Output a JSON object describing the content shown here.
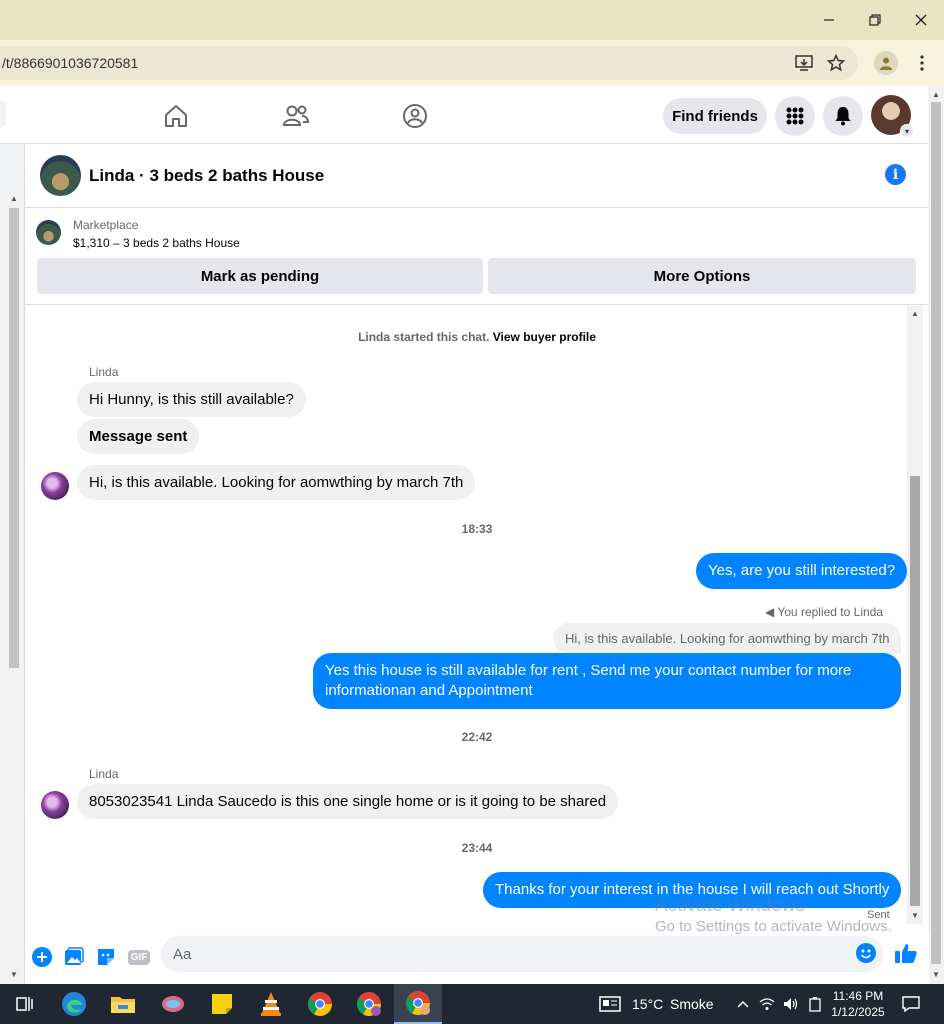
{
  "browser": {
    "url": "/t/8866901036720581",
    "window_controls": [
      "minimize",
      "restore",
      "close"
    ]
  },
  "header": {
    "find_friends": "Find friends"
  },
  "chat": {
    "title": "Linda · 3 beds 2 baths House",
    "listing": {
      "label": "Marketplace",
      "title": "$1,310 – 3 beds 2 baths House",
      "mark_pending": "Mark as pending",
      "more_options": "More Options"
    },
    "system_line": "Linda started this chat.",
    "view_buyer_profile": "View buyer profile",
    "messages": {
      "sender1": "Linda",
      "m1": "Hi Hunny, is this still available?",
      "m2": "Message sent",
      "m3": "Hi, is this available. Looking for aomwthing by march 7th",
      "time1": "18:33",
      "o1": "Yes, are you still interested?",
      "replied_to": "You replied to Linda",
      "quote": "Hi, is this available. Looking for aomwthing by march 7th",
      "o2": "Yes this house is still available for rent , Send me your contact number for more informationan and Appointment",
      "time2": "22:42",
      "sender2": "Linda",
      "m4": "8053023541 Linda Saucedo is this one single home or is it going to be  shared",
      "time3": "23:44",
      "o3": "Thanks for your interest in the house I will reach out Shortly",
      "status": "Sent"
    },
    "composer": {
      "placeholder": "Aa",
      "gif": "GIF"
    }
  },
  "watermark": {
    "line1": "Activate Windows",
    "line2": "Go to Settings to activate Windows."
  },
  "taskbar": {
    "weather_temp": "15°C",
    "weather_desc": "Smoke",
    "time": "11:46 PM",
    "date": "1/12/2025"
  },
  "colors": {
    "messenger_blue": "#0084ff",
    "fb_blue": "#1877f2",
    "title_bar": "#e9e3c1"
  }
}
